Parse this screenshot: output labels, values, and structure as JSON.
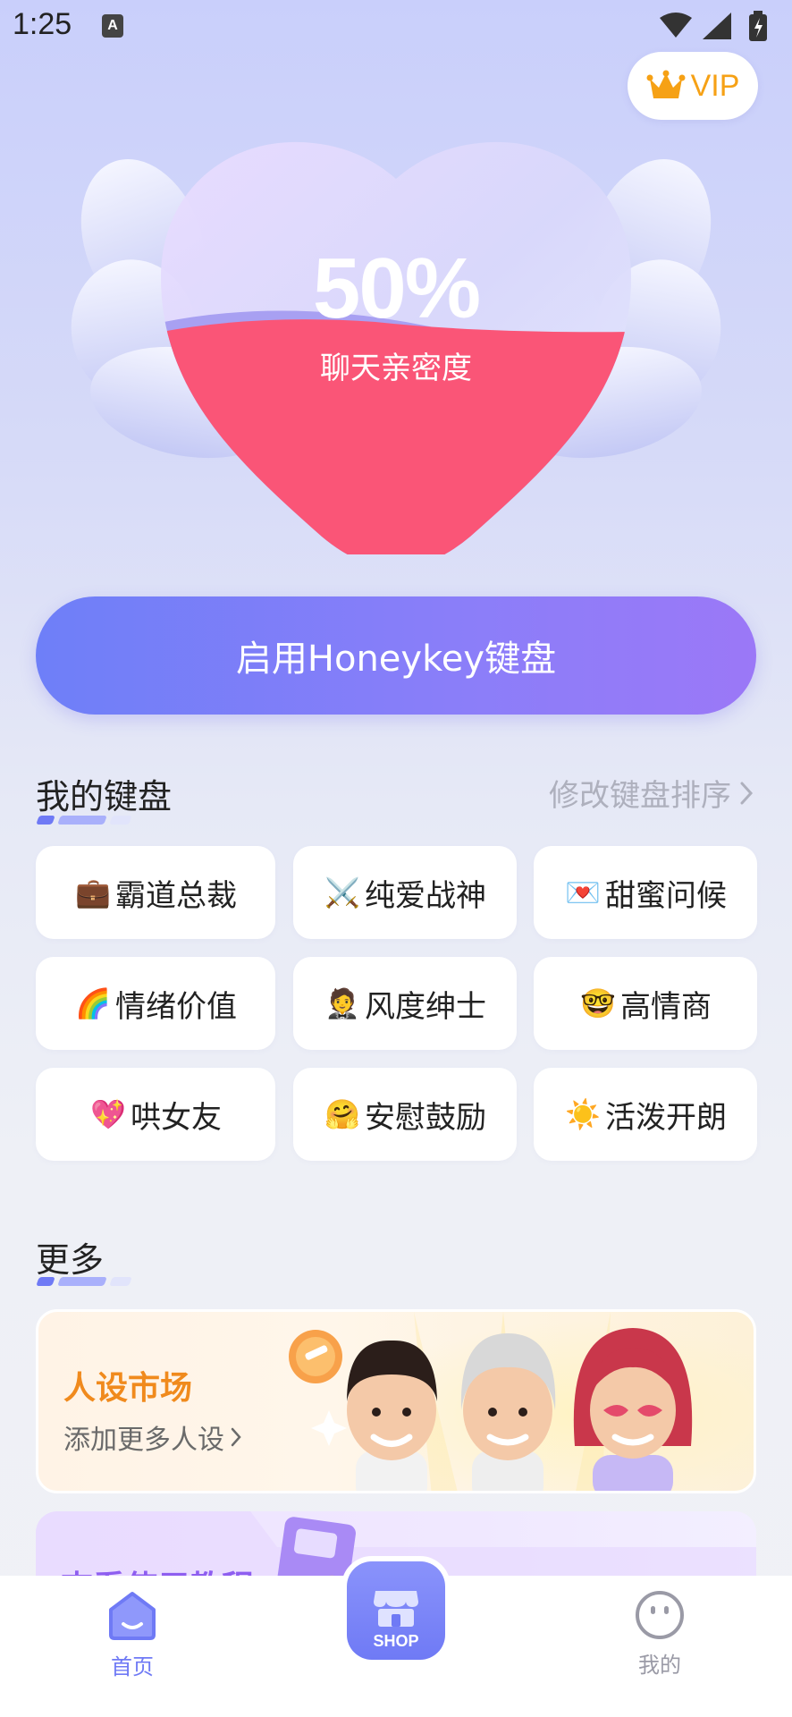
{
  "status_bar": {
    "time": "1:25",
    "app_icon_letter": "A"
  },
  "vip": {
    "label": "VIP"
  },
  "heart": {
    "percent": "50%",
    "label": "聊天亲密度"
  },
  "enable_button": {
    "label": "启用Honeykey键盘"
  },
  "my_keyboard": {
    "title": "我的键盘",
    "sort_link": "修改键盘排序",
    "items": [
      {
        "emoji": "💼",
        "label": "霸道总裁"
      },
      {
        "emoji": "⚔️",
        "label": "纯爱战神"
      },
      {
        "emoji": "💌",
        "label": "甜蜜问候"
      },
      {
        "emoji": "🌈",
        "label": "情绪价值"
      },
      {
        "emoji": "🤵",
        "label": "风度绅士"
      },
      {
        "emoji": "🤓",
        "label": "高情商"
      },
      {
        "emoji": "💖",
        "label": "哄女友"
      },
      {
        "emoji": "🤗",
        "label": "安慰鼓励"
      },
      {
        "emoji": "☀️",
        "label": "活泼开朗"
      }
    ]
  },
  "more": {
    "title": "更多",
    "market": {
      "title": "人设市场",
      "subtitle": "添加更多人设"
    },
    "tutorial": {
      "title": "查看使用教程"
    }
  },
  "bottom_nav": {
    "home": "首页",
    "shop": "SHOP",
    "mine": "我的"
  },
  "colors": {
    "accent": "#6f7af5",
    "heart_red": "#fa5577",
    "vip_gold": "#f6a115",
    "market_orange": "#f08a1d"
  }
}
